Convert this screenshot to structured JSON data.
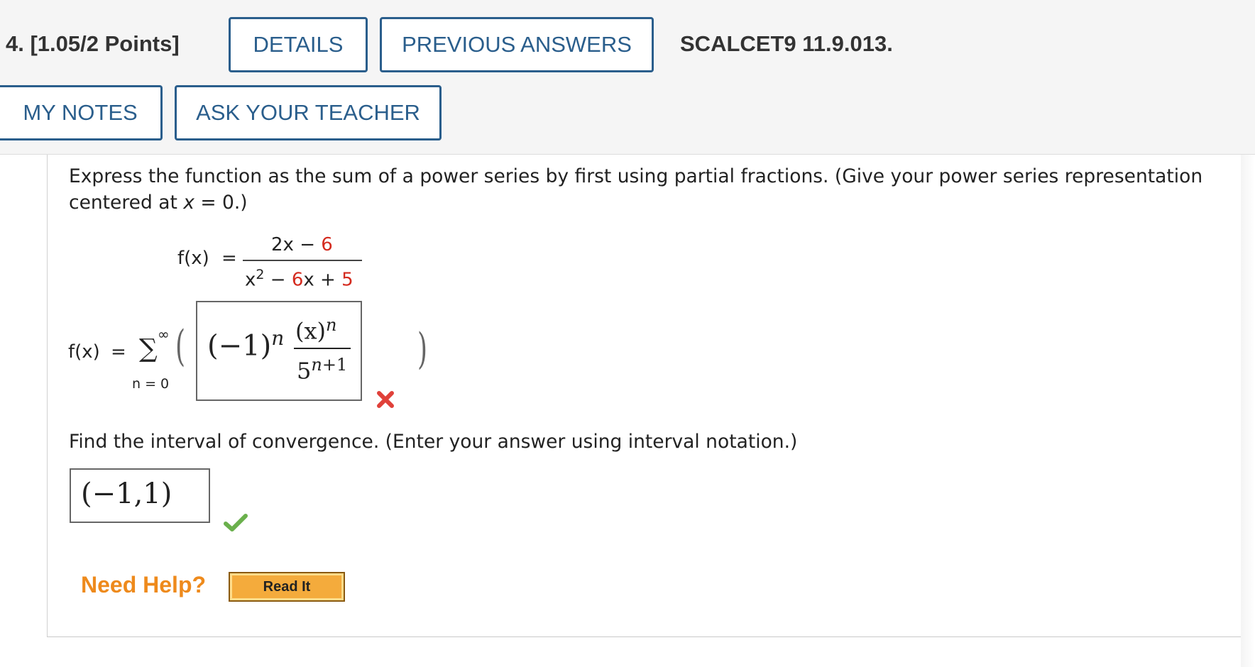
{
  "header": {
    "points_label": "4.  [1.05/2 Points]",
    "details_button": "DETAILS",
    "previous_answers_button": "PREVIOUS ANSWERS",
    "problem_ref": "SCALCET9 11.9.013.",
    "my_notes_button": "MY NOTES",
    "ask_teacher_button": "ASK YOUR TEACHER"
  },
  "question": {
    "line1": "Express the function as the sum of a power series by first using partial fractions. (Give your power series representation",
    "line2_prefix": "centered at ",
    "line2_var": "x",
    "line2_suffix": " = 0.)",
    "interval_prompt": "Find the interval of convergence. (Enter your answer using interval notation.)"
  },
  "function_display": {
    "lhs": "f(x)",
    "eq": "=",
    "numerator_term": "2x",
    "numerator_op": "−",
    "numerator_const": "6",
    "denominator_var": "x",
    "denominator_exp": "2",
    "denominator_op1": "−",
    "denominator_coef": "6",
    "denominator_mid": "x",
    "denominator_op2": "+",
    "denominator_const": "5"
  },
  "series": {
    "lhs": "f(x)",
    "eq": "=",
    "sigma": "∑",
    "upper": "∞",
    "lower": "n = 0",
    "open_paren": "(",
    "close_paren": ")",
    "answer": {
      "neg_one": "(−1)",
      "neg_one_exp": "n",
      "numerator": "(x)",
      "numerator_exp": "n",
      "denominator_base": "5",
      "denominator_exp": "n+1"
    },
    "status_icon": "incorrect-x-icon",
    "status_color": "#e0413a"
  },
  "interval": {
    "answer": "(−1,1)",
    "status_icon": "correct-check-icon",
    "status_color": "#6ab04c"
  },
  "help": {
    "label": "Need Help?",
    "read_it_button": "Read It"
  },
  "colors": {
    "accent": "#2a5e8c",
    "constant_red": "#d42a1e",
    "help_orange": "#ee8a1c"
  }
}
